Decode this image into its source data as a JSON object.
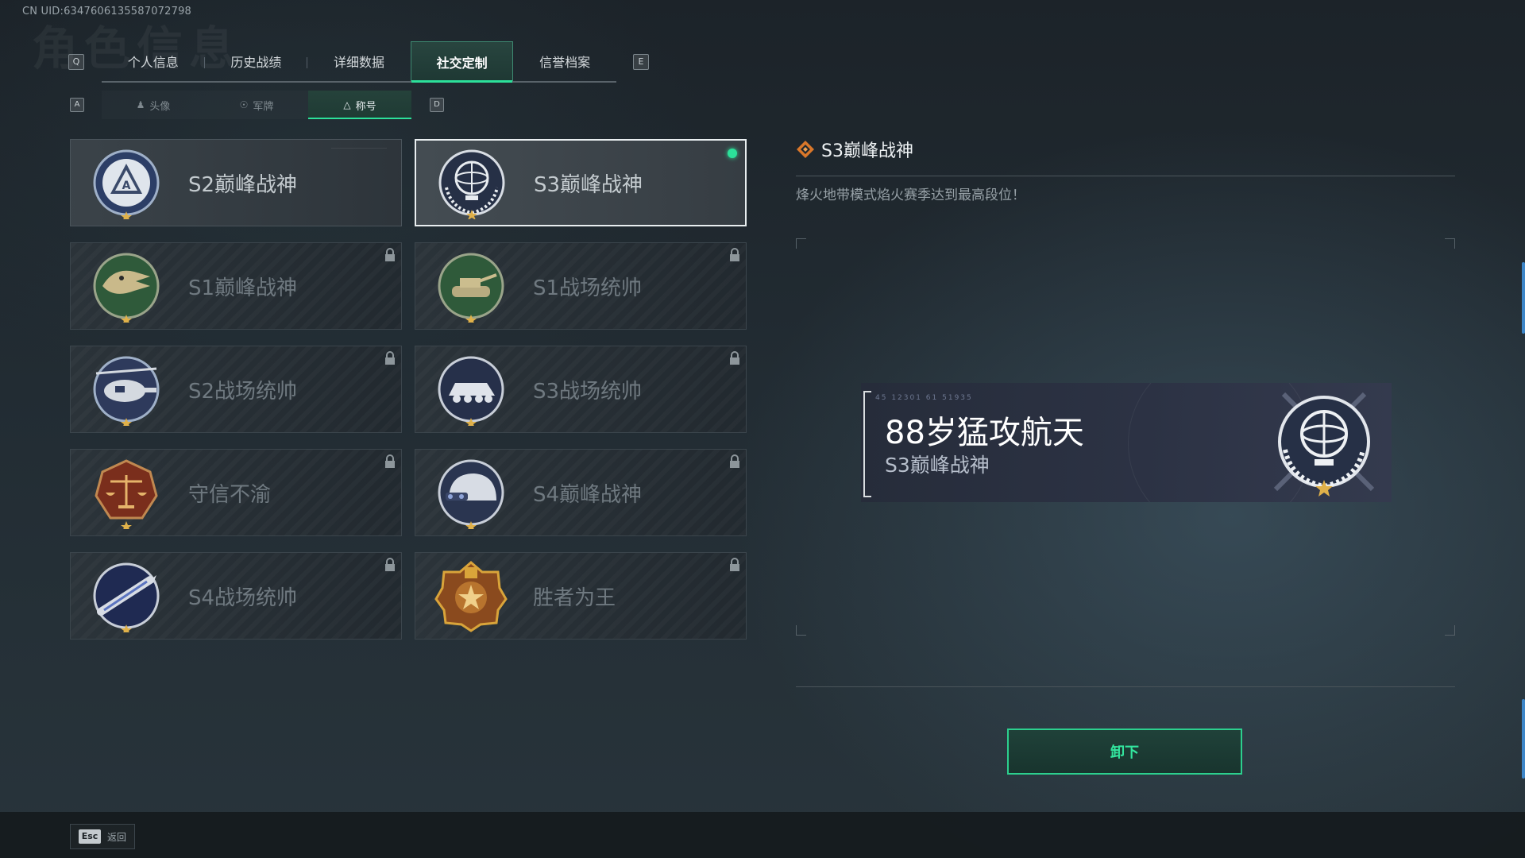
{
  "uid": "CN UID:6347606135587072798",
  "watermark": "角色信息",
  "keys": {
    "prev_tab": "Q",
    "next_tab": "E",
    "prev_sub": "A",
    "next_sub": "D"
  },
  "tabs": [
    {
      "label": "个人信息",
      "active": false
    },
    {
      "label": "历史战绩",
      "active": false
    },
    {
      "label": "详细数据",
      "active": false
    },
    {
      "label": "社交定制",
      "active": true
    },
    {
      "label": "信誉档案",
      "active": false
    }
  ],
  "subtabs": [
    {
      "label": "头像",
      "icon": "person-icon",
      "active": false
    },
    {
      "label": "军牌",
      "icon": "dogtag-icon",
      "active": false
    },
    {
      "label": "称号",
      "icon": "triangle-icon",
      "active": true
    }
  ],
  "titles": [
    {
      "name": "S2巅峰战神",
      "emblem": "shield-emblem-icon",
      "locked": false,
      "selected": false
    },
    {
      "name": "S3巅峰战神",
      "emblem": "globe-trophy-emblem-icon",
      "locked": false,
      "selected": true
    },
    {
      "name": "S1巅峰战神",
      "emblem": "crocodile-emblem-icon",
      "locked": true,
      "selected": false
    },
    {
      "name": "S1战场统帅",
      "emblem": "tank-emblem-icon",
      "locked": true,
      "selected": false
    },
    {
      "name": "S2战场统帅",
      "emblem": "helicopter-emblem-icon",
      "locked": true,
      "selected": false
    },
    {
      "name": "S3战场统帅",
      "emblem": "apc-emblem-icon",
      "locked": true,
      "selected": false
    },
    {
      "name": "守信不渝",
      "emblem": "scales-emblem-icon",
      "locked": true,
      "selected": false
    },
    {
      "name": "S4巅峰战神",
      "emblem": "helmet-emblem-icon",
      "locked": true,
      "selected": false
    },
    {
      "name": "S4战场统帅",
      "emblem": "missile-emblem-icon",
      "locked": true,
      "selected": false
    },
    {
      "name": "胜者为王",
      "emblem": "medal-emblem-icon",
      "locked": true,
      "selected": false
    }
  ],
  "detail": {
    "name": "S3巅峰战神",
    "description": "烽火地带模式焰火赛季达到最高段位！"
  },
  "banner": {
    "codes": "45 12301   61 51935",
    "player_name": "88岁猛攻航天",
    "title": "S3巅峰战神"
  },
  "action_button": "卸下",
  "footer": {
    "esc_key": "Esc",
    "back_label": "返回"
  },
  "colors": {
    "accent": "#2ce09a",
    "selected_border": "#e9eef0",
    "gold": "#d9a43a"
  }
}
